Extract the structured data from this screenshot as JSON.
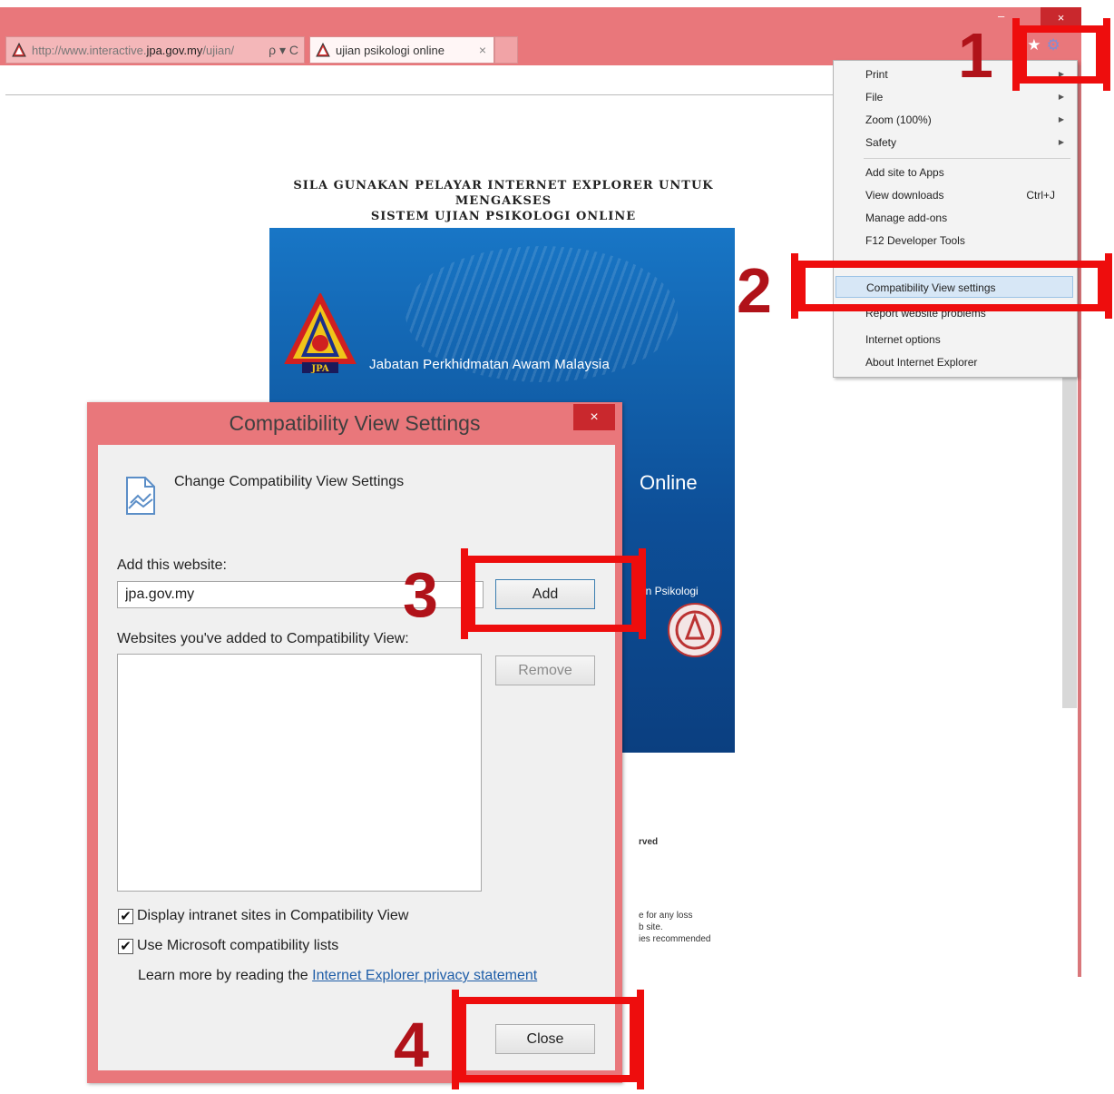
{
  "browser": {
    "url_prefix": "http://www.interactive.",
    "url_domain": "jpa.gov.my",
    "url_suffix": "/ujian/",
    "url_tools": "ρ ▾ C",
    "tab_title": "ujian psikologi online",
    "tab_close": "×",
    "minimize": "–",
    "close": "×",
    "colors": {
      "titlebar": "#e9777b",
      "close_button": "#c9282d"
    }
  },
  "page": {
    "notice_line1": "SILA GUNAKAN PELAYAR INTERNET EXPLORER UNTUK MENGAKSES",
    "notice_line2": "SISTEM UJIAN PSIKOLOGI ONLINE",
    "banner_agency": "Jabatan Perkhidmatan Awam Malaysia",
    "banner_logo": "JPA",
    "banner_online": "Online",
    "banner_psikologi": "an Psikologi",
    "footer_rved": "rved",
    "footer_loss": "e for any loss",
    "footer_site": "b site.",
    "footer_recommended": "ies recommended"
  },
  "tools_menu": {
    "items": [
      {
        "label": "Print",
        "submenu": true
      },
      {
        "label": "File",
        "submenu": true
      },
      {
        "label": "Zoom (100%)",
        "submenu": true
      },
      {
        "label": "Safety",
        "submenu": true
      },
      {
        "label": "Add site to Apps"
      },
      {
        "label": "View downloads",
        "shortcut": "Ctrl+J"
      },
      {
        "label": "Manage add-ons"
      },
      {
        "label": "F12 Developer Tools"
      },
      {
        "label": "Compatibility View settings",
        "highlighted": true
      },
      {
        "label": "Report website problems"
      },
      {
        "label": "Internet options"
      },
      {
        "label": "About Internet Explorer"
      }
    ]
  },
  "dialog": {
    "title": "Compatibility View Settings",
    "close_glyph": "×",
    "heading": "Change Compatibility View Settings",
    "add_label": "Add this website:",
    "input_value": "jpa.gov.my",
    "add_button": "Add",
    "list_label": "Websites you've added to Compatibility View:",
    "remove_button": "Remove",
    "checkbox_intranet": "Display intranet sites in Compatibility View",
    "checkbox_intranet_checked": true,
    "checkbox_ms_lists": "Use Microsoft compatibility lists",
    "checkbox_ms_lists_checked": true,
    "learn_more": "Learn more by reading the ",
    "privacy_link": "Internet Explorer privacy statement",
    "close_button": "Close",
    "check_glyph": "✔"
  },
  "annotations": {
    "step1": "1",
    "step2": "2",
    "step3": "3",
    "step4": "4",
    "color": "#ee0d0d"
  }
}
